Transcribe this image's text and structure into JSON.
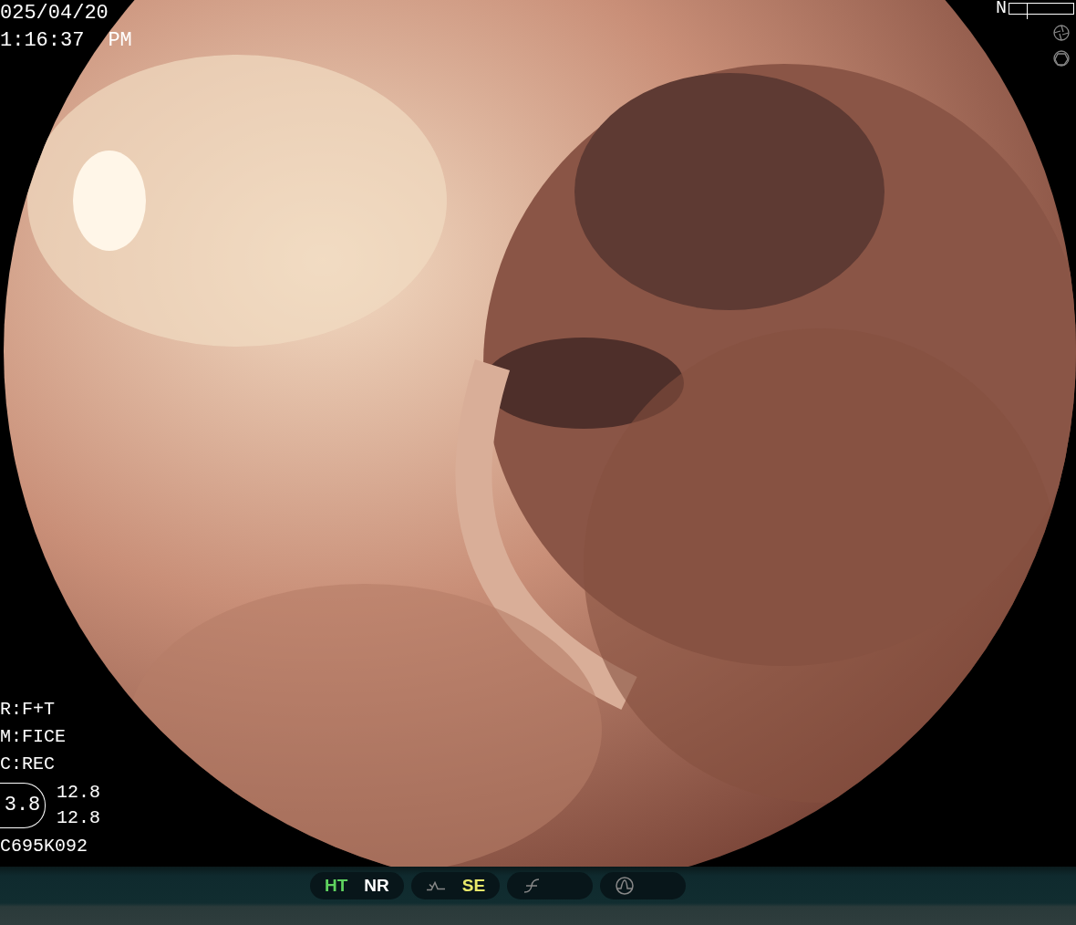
{
  "header": {
    "date": "025/04/20",
    "time": "1:16:37",
    "meridiem": "PM",
    "gauge": {
      "label": "N",
      "level": 0.27
    }
  },
  "info": {
    "lines": [
      "R:F+T",
      "M:FICE",
      "C:REC"
    ],
    "badge": "3.8",
    "readings": [
      "12.8",
      "12.8"
    ],
    "code": "C695K092"
  },
  "status_bar": {
    "groups": [
      {
        "items": [
          {
            "kind": "text",
            "label": "HT",
            "color": "#5fd35f"
          },
          {
            "kind": "text",
            "label": "NR",
            "color": "#ffffff"
          }
        ]
      },
      {
        "items": [
          {
            "kind": "icon"
          },
          {
            "kind": "text",
            "label": "SE",
            "color": "#e8e86a"
          }
        ]
      },
      {
        "items": [
          {
            "kind": "curve"
          }
        ]
      },
      {
        "items": [
          {
            "kind": "wave"
          }
        ]
      }
    ]
  }
}
